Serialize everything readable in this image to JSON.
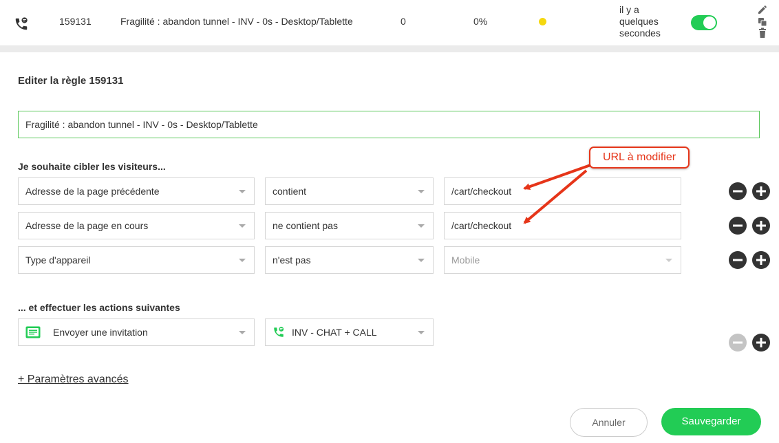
{
  "rule_row": {
    "id": "159131",
    "name": "Fragilité : abandon tunnel - INV - 0s - Desktop/Tablette",
    "count": "0",
    "percent": "0%",
    "status_color": "#f5d80f",
    "timeago": "il y a quelques secondes",
    "toggle_on": true,
    "toggle_color": "#22cc55"
  },
  "editor": {
    "title": "Editer la règle 159131",
    "name_value": "Fragilité : abandon tunnel - INV - 0s - Desktop/Tablette",
    "target_label": "Je souhaite cibler les visiteurs...",
    "conditions": [
      {
        "field": "Adresse de la page précédente",
        "operator": "contient",
        "value": "/cart/checkout"
      },
      {
        "field": "Adresse de la page en cours",
        "operator": "ne contient pas",
        "value": "/cart/checkout"
      },
      {
        "field": "Type d'appareil",
        "operator": "n'est pas",
        "value": "Mobile"
      }
    ],
    "actions_label": "... et effectuer les actions suivantes",
    "action": {
      "type": "Envoyer une invitation",
      "target": "INV - CHAT + CALL"
    },
    "advanced_link": "+ Paramètres avancés",
    "cancel_label": "Annuler",
    "save_label": "Sauvegarder"
  },
  "annotation": {
    "text": "URL à modifier",
    "color": "#e63519"
  },
  "colors": {
    "accent_green": "#22cc55",
    "input_border_active": "#5cc85c",
    "dark_button": "#333333"
  },
  "icons": {
    "row_type": "phone-chat-icon",
    "edit": "pencil-icon",
    "duplicate": "copy-icon",
    "delete": "trash-icon",
    "remove": "minus-circle-icon",
    "add": "plus-circle-icon",
    "invitation": "chat-window-icon",
    "call": "phone-icon"
  }
}
